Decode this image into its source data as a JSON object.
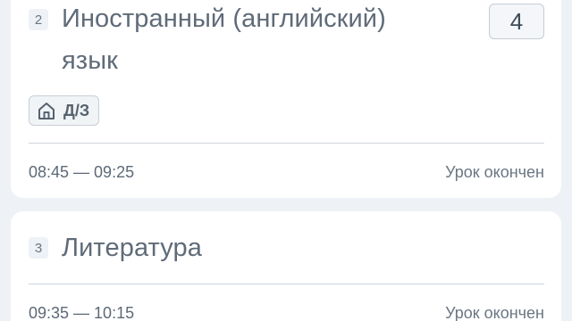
{
  "lessons": [
    {
      "number": "2",
      "subject_line1": "Иностранный (английский)",
      "subject_line2": "язык",
      "grade": "4",
      "homework_label": "Д/З",
      "homework_icon": "home-icon",
      "time": "08:45 — 09:25",
      "status": "Урок окончен"
    },
    {
      "number": "3",
      "subject_line1": "Литература",
      "time": "09:35 — 10:15",
      "status": "Урок окончен"
    }
  ],
  "colors": {
    "background": "#eef1f5",
    "card": "#ffffff",
    "text": "#5f6b78",
    "border": "#c5ccd4"
  }
}
